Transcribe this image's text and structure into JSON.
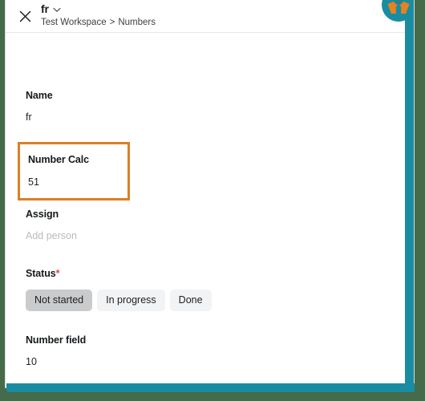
{
  "window": {
    "backdrop_color": "#456b4a",
    "rail_color": "#1a8ca2",
    "panel_background": "#ffffff"
  },
  "header": {
    "close_icon": "close-icon",
    "record_title": "fr",
    "title_chevron_icon": "chevron-down-icon",
    "breadcrumb": {
      "workspace": "Test Workspace",
      "separator": ">",
      "table": "Numbers"
    },
    "avatar_icon": "avatar-logo-icon",
    "avatar_colors": {
      "teal": "#1a8ca2",
      "orange": "#e8821f"
    }
  },
  "form": {
    "fields": [
      {
        "name": "name",
        "label": "Name",
        "value": "fr",
        "type": "text",
        "highlighted": false
      },
      {
        "name": "number-calc",
        "label": "Number Calc",
        "value": "51",
        "type": "number",
        "highlighted": true,
        "highlight_color": "#dd7e25"
      },
      {
        "name": "assign",
        "label": "Assign",
        "placeholder": "Add person",
        "value": "",
        "type": "person",
        "highlighted": false
      },
      {
        "name": "status",
        "label": "Status",
        "required": true,
        "required_marker": "*",
        "type": "single-select",
        "options": [
          "Not started",
          "In progress",
          "Done"
        ],
        "selected": "Not started",
        "highlighted": false
      },
      {
        "name": "number-field",
        "label": "Number field",
        "value": "10",
        "type": "number",
        "highlighted": false
      }
    ]
  }
}
